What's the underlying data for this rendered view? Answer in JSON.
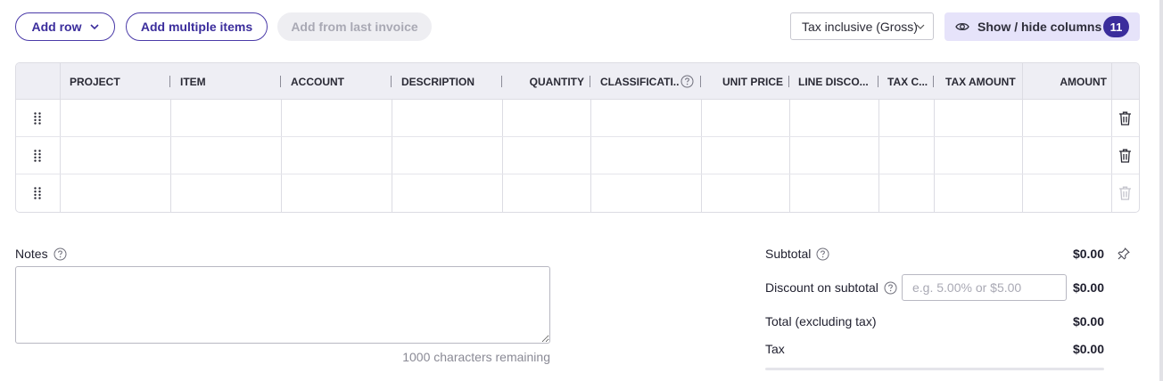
{
  "toolbar": {
    "add_row_label": "Add row",
    "add_multiple_label": "Add multiple items",
    "add_last_invoice_label": "Add from last invoice",
    "tax_mode": "Tax inclusive (Gross)",
    "columns_label": "Show / hide columns",
    "columns_count": "11"
  },
  "table": {
    "columns": [
      "PROJECT",
      "ITEM",
      "ACCOUNT",
      "DESCRIPTION",
      "QUANTITY",
      "CLASSIFICATI...",
      "UNIT PRICE",
      "LINE DISCO...",
      "TAX C...",
      "TAX AMOUNT",
      "AMOUNT"
    ],
    "row_count": 3,
    "rows": [
      {
        "delete_enabled": true
      },
      {
        "delete_enabled": true
      },
      {
        "delete_enabled": false
      }
    ]
  },
  "notes": {
    "label": "Notes",
    "value": "",
    "remaining_text": "1000 characters remaining"
  },
  "summary": {
    "subtotal_label": "Subtotal",
    "subtotal_value": "$0.00",
    "discount_label": "Discount on subtotal",
    "discount_placeholder": "e.g. 5.00% or $5.00",
    "discount_value": "$0.00",
    "total_ex_tax_label": "Total (excluding tax)",
    "total_ex_tax_value": "$0.00",
    "tax_label": "Tax",
    "tax_value": "$0.00"
  },
  "colors": {
    "accent": "#3b2d9c",
    "accent_light": "#e6e3fa",
    "header_bg": "#eeeef4",
    "border": "#dcdce3"
  },
  "icons": {
    "add_row_chevron": "chevron-down-icon",
    "tax_select_chevron": "chevron-down-icon",
    "columns": "eye-icon",
    "row_handle": "drag-handle-icon",
    "row_delete": "trash-icon",
    "help": "help-circle-icon",
    "pin": "pin-icon"
  }
}
